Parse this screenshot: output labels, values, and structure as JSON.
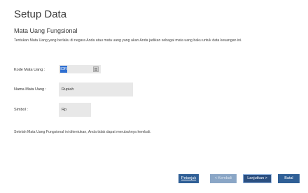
{
  "header": {
    "title": "Setup Data",
    "section_title": "Mata Uang Fungsional",
    "description": "Tentukan Mata Uang yang berlaku di negara Anda atau mata uang yang akan Anda jadikan sebagai mata uang baku untuk data keuangan ini."
  },
  "form": {
    "code_label": "Kode Mata Uang :",
    "code_value": "IDR",
    "name_label": "Nama Mata Uang :",
    "name_value": "Rupiah",
    "symbol_label": "Simbol :",
    "symbol_value": "Rp",
    "lookup_icon": "list-icon"
  },
  "note": "Setelah Mata Uang Fungsional ini ditentukan, Anda tidak dapat merubahnya kembali.",
  "buttons": {
    "help": "Petunjuk",
    "back": "< Kembali",
    "next": "Lanjutkan >",
    "cancel": "Batal"
  },
  "colors": {
    "primary_button": "#2f5f96",
    "selection": "#2f6fd1",
    "input_bg": "#e8e8e8"
  }
}
